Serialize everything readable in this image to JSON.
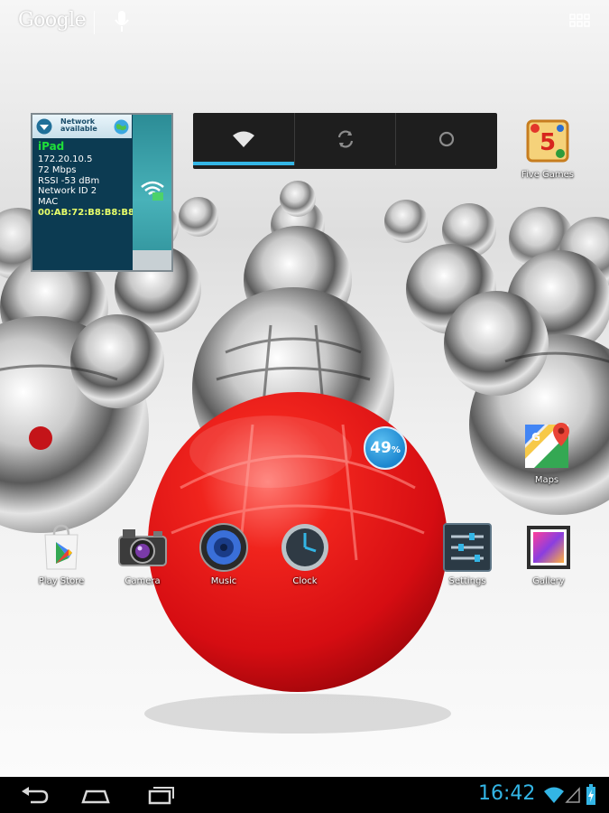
{
  "search": {
    "logo": "Google"
  },
  "network_widget": {
    "status": "Network available",
    "ssid": "iPad",
    "details": [
      "172.20.10.5",
      "72 Mbps",
      "RSSI -53 dBm",
      "Network ID 2",
      "MAC"
    ],
    "mac": "00:AB:72:B8:B8:B8"
  },
  "toggle_widget": {
    "icons": [
      "wifi-icon",
      "sync-icon",
      "brightness-icon"
    ],
    "active_index": 0
  },
  "apps": {
    "five_games": "Five Games",
    "maps": "Maps",
    "play_store": "Play Store",
    "camera": "Camera",
    "music": "Music",
    "clock": "Clock",
    "settings": "Settings",
    "gallery": "Gallery"
  },
  "battery_widget": {
    "value": "49",
    "unit": "%"
  },
  "status_bar": {
    "time": "16:42"
  },
  "colors": {
    "accent": "#33b5e5",
    "red_ball": "#e8141a",
    "nav_bg": "#000000"
  }
}
